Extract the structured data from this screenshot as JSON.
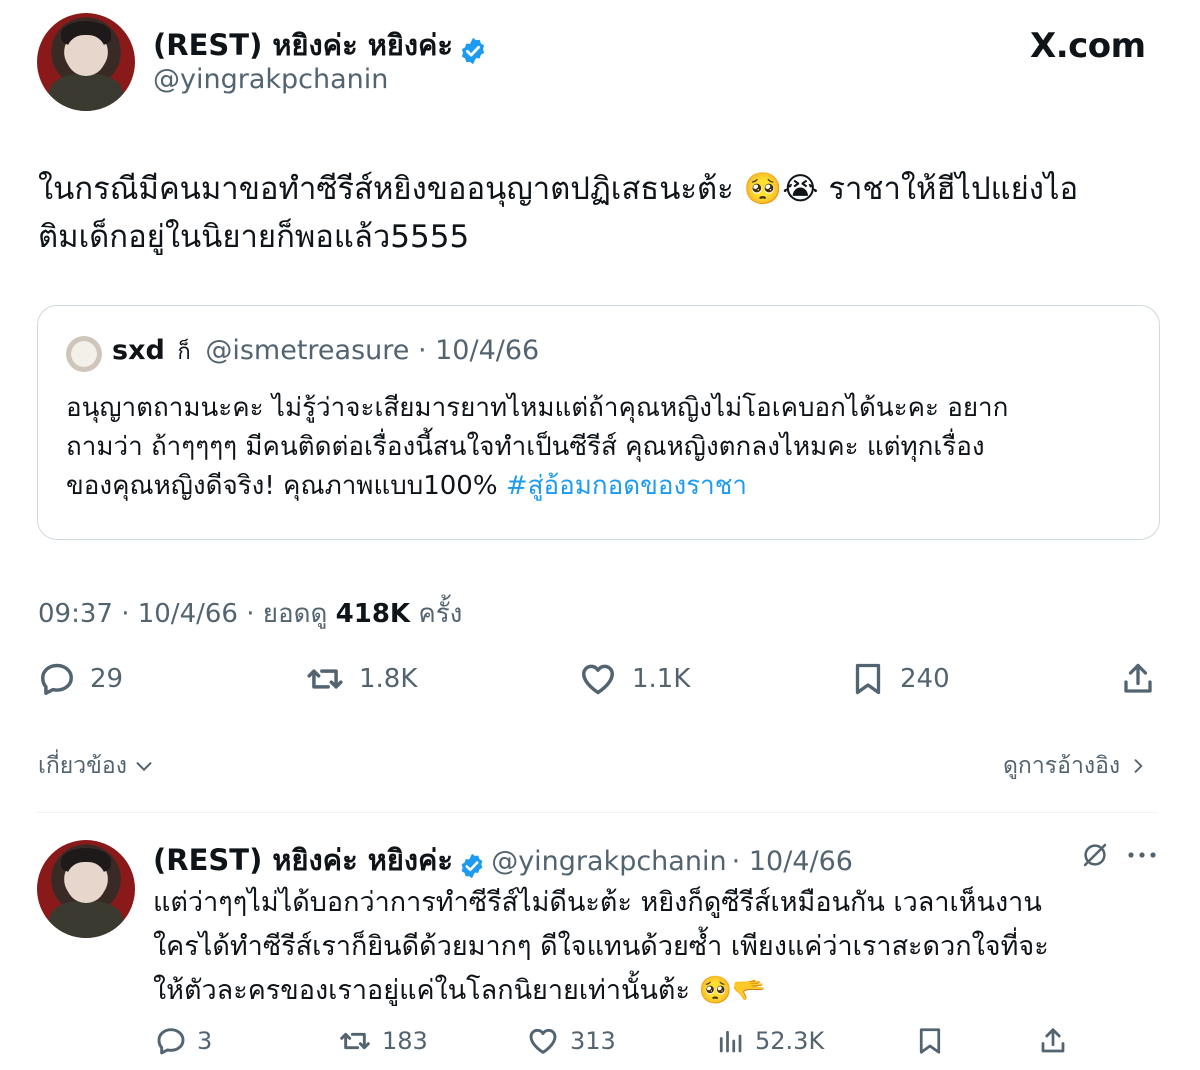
{
  "site": {
    "logo_text": "X.com"
  },
  "main_tweet": {
    "display_name": "(REST) หยิงค่ะ หยิงค่ะ",
    "handle": "@yingrakpchanin",
    "text_line1": "ในกรณีมีคนมาขอทำซีรีส์หยิงขออนุญาตปฏิเสธนะต้ะ 🥺😭 ราชาให้ฮีไปแย่งไอ",
    "text_line2": "ติมเด็กอยู่ในนิยายก็พอแล้ว5555",
    "time": "09:37 · 10/4/66 · ยอดดู",
    "views": "418K",
    "views_suffix": "ครั้ง",
    "replies": "29",
    "reposts": "1.8K",
    "likes": "1.1K",
    "bookmarks": "240"
  },
  "quoted_tweet": {
    "display_name": "sxd",
    "name_glyph": "ก็",
    "handle": "@ismetreasure",
    "date": "· 10/4/66",
    "line1": "อนุญาตถามนะคะ ไม่รู้ว่าจะเสียมารยาทไหมแต่ถ้าคุณหญิงไม่โอเคบอกได้นะคะ อยาก",
    "line2": "ถามว่า ถ้าๆๆๆๆ มีคนติดต่อเรื่องนี้สนใจทำเป็นซีรีส์ คุณหญิงตกลงไหมคะ แต่ทุกเรื่อง",
    "line3": "ของคุณหญิงดีจริง! คุณภาพแบบ100%",
    "hashtag": "#สู่อ้อมกอดของราชา"
  },
  "nav": {
    "related": "เกี่ยวข้อง",
    "view_quotes": "ดูการอ้างอิง"
  },
  "reply_tweet": {
    "display_name": "(REST) หยิงค่ะ หยิงค่ะ",
    "handle": "@yingrakpchanin",
    "date": "· 10/4/66",
    "line1": "แต่ว่าๆๆไม่ได้บอกว่าการทำซีรีส์ไม่ดีนะต้ะ หยิงก็ดูซีรีส์เหมือนกัน เวลาเห็นงาน",
    "line2": "ใครได้ทำซีรีส์เราก็ยินดีด้วยมากๆ ดีใจแทนด้วยซ้ำ เพียงแค่ว่าเราสะดวกใจที่จะ",
    "line3": "ให้ตัวละครของเราอยู่แค่ในโลกนิยายเท่านั้นต้ะ 🥺🫳",
    "replies": "3",
    "reposts": "183",
    "likes": "313",
    "views": "52.3K"
  },
  "colors": {
    "verified": "#1d9bf0",
    "link": "#1d9bf0",
    "muted": "#536471"
  }
}
